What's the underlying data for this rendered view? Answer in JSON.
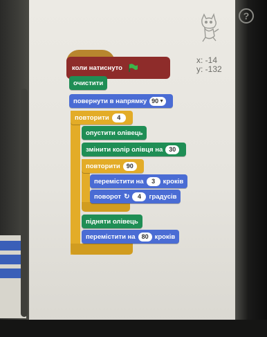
{
  "help": {
    "label": "?"
  },
  "sprite": {
    "x_label": "x: -14",
    "y_label": "y: -132"
  },
  "script": {
    "hat": {
      "label": "коли натиснуто"
    },
    "clear": {
      "label": "очистити"
    },
    "point": {
      "label": "повернути в напрямку",
      "value": "90"
    },
    "repeat_outer": {
      "label": "повторити",
      "value": "4"
    },
    "pen_down": {
      "label": "опустити олівець"
    },
    "change_color": {
      "label": "змінити колір олівця на",
      "value": "30"
    },
    "repeat_inner": {
      "label": "повторити",
      "value": "90"
    },
    "move_inner": {
      "label": "перемістити на",
      "value": "3",
      "suffix": "кроків"
    },
    "turn": {
      "label": "поворот",
      "value": "4",
      "suffix": "градусів"
    },
    "pen_up": {
      "label": "підняти олівець"
    },
    "move_outer": {
      "label": "перемістити на",
      "value": "80",
      "suffix": "кроків"
    }
  },
  "colors": {
    "events": "#b8862e",
    "pen": "#1f8e55",
    "motion": "#4a6cd4",
    "control": "#e3ac28"
  }
}
